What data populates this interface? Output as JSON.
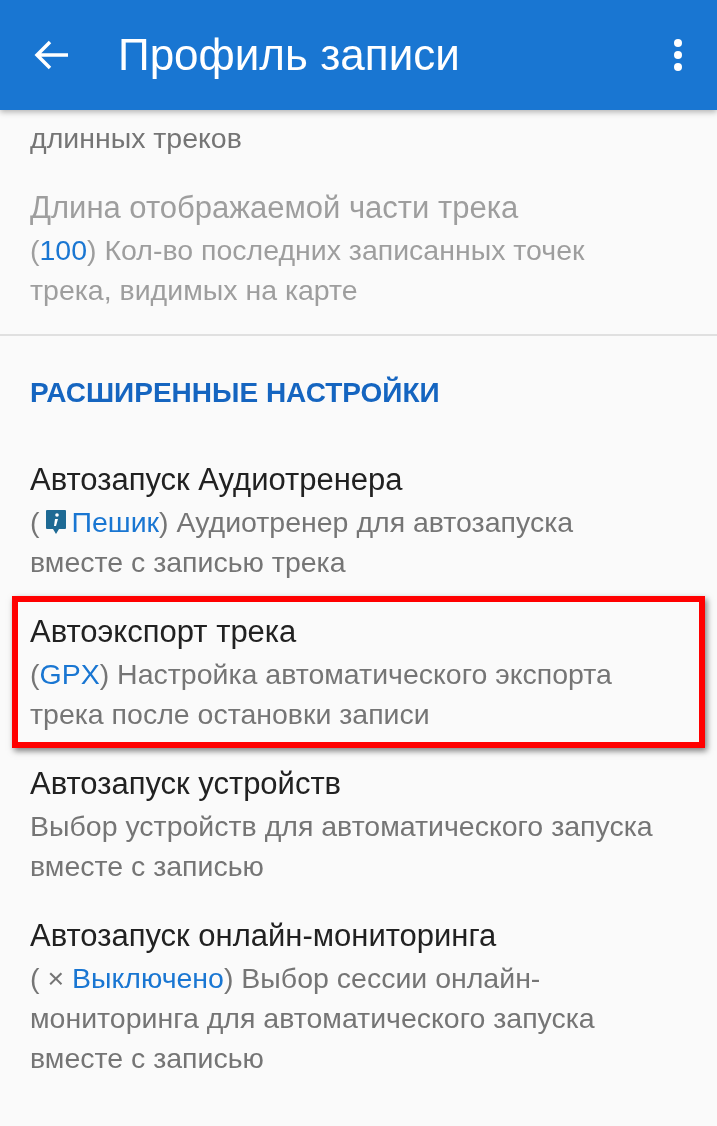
{
  "app_bar": {
    "title": "Профиль записи"
  },
  "items": [
    {
      "kind": "setting",
      "rest": "длинных треков",
      "disabled": false,
      "highlighted": false
    },
    {
      "kind": "setting",
      "title": "Длина отображаемой части трека",
      "prefix": "(",
      "value": "100",
      "rest": ") Кол-во последних записанных точек трека, видимых на карте",
      "disabled": true,
      "highlighted": false
    },
    {
      "kind": "header",
      "title": "РАСШИРЕННЫЕ НАСТРОЙКИ"
    },
    {
      "kind": "setting",
      "title": "Автозапуск Аудиотренера",
      "prefix": "(",
      "info_badge": true,
      "value": "Пешик",
      "rest": ") Аудиотренер для автозапуска вместе с записью трека",
      "disabled": false,
      "highlighted": false
    },
    {
      "kind": "setting",
      "title": "Автоэкспорт трека",
      "prefix": "(",
      "value": "GPX",
      "rest": ") Настройка автоматического экспорта трека после остановки записи",
      "disabled": false,
      "highlighted": true
    },
    {
      "kind": "setting",
      "title": "Автозапуск устройств",
      "rest": "Выбор устройств для автоматического запуска вместе с записью",
      "disabled": false,
      "highlighted": false
    },
    {
      "kind": "setting",
      "title": "Автозапуск онлайн-мониторинга",
      "prefix": "( × ",
      "value": "Выключено",
      "rest": ") Выбор сессии онлайн-мониторинга для автоматического запуска вместе с записью",
      "disabled": false,
      "highlighted": false
    }
  ]
}
